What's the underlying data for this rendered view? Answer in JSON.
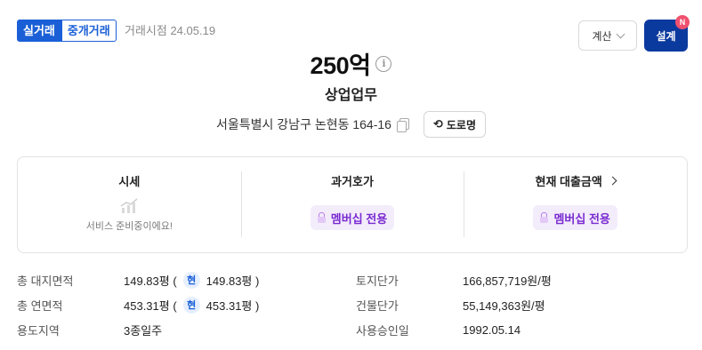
{
  "header": {
    "tab_actual": "실거래",
    "tab_brokered": "중개거래",
    "deal_date": "거래시점 24.05.19",
    "calc_label": "계산",
    "design_label": "설계",
    "new_badge": "N"
  },
  "summary": {
    "price": "250억",
    "category": "상업업무",
    "address": "서울특별시 강남구 논현동 164-16",
    "road_name_label": "도로명"
  },
  "cards": {
    "market_title": "시세",
    "market_status": "서비스 준비중이에요!",
    "past_price_title": "과거호가",
    "past_price_value": "멤버십 전용",
    "loan_title": "현재 대출금액",
    "loan_value": "멤버십 전용"
  },
  "specs": {
    "land_area_label": "총 대지면적",
    "land_area_value": "149.83평 (",
    "land_area_current_badge": "현",
    "land_area_current_value": "149.83평 )",
    "floor_area_label": "총 연면적",
    "floor_area_value": "453.31평 (",
    "floor_area_current_badge": "현",
    "floor_area_current_value": "453.31평 )",
    "zoning_label": "용도지역",
    "zoning_value": "3종일주",
    "land_price_label": "토지단가",
    "land_price_value": "166,857,719원/평",
    "building_price_label": "건물단가",
    "building_price_value": "55,149,363원/평",
    "approval_label": "사용승인일",
    "approval_value": "1992.05.14"
  },
  "colors": {
    "primary_blue": "#1a5fd6",
    "navy_button": "#0b3a9e",
    "badge_red": "#f0506e",
    "membership_purple": "#7a2bd1",
    "membership_bg": "#f3ecfb"
  },
  "icons": {
    "info": "info-icon",
    "copy": "copy-icon",
    "swap": "swap-icon",
    "chevron_down": "chevron-down-icon",
    "chevron_right": "chevron-right-icon",
    "chart": "chart-icon",
    "lock": "lock-icon"
  }
}
